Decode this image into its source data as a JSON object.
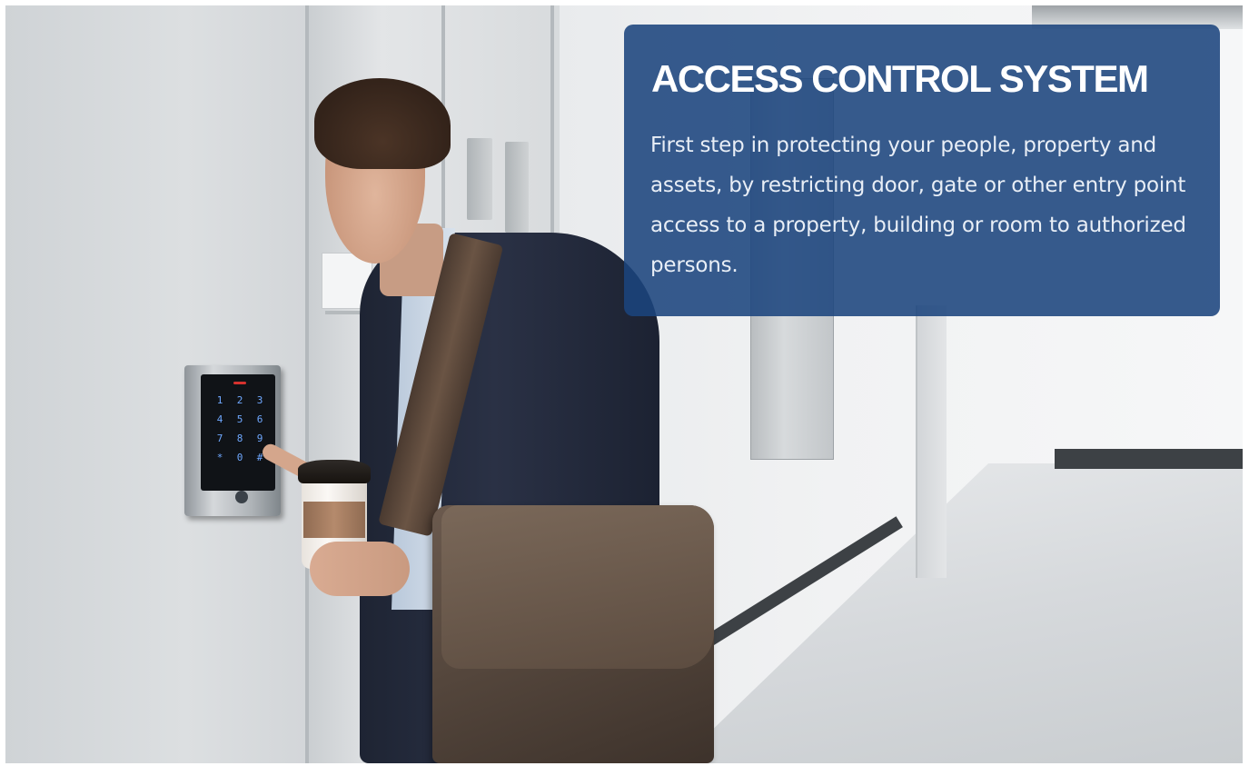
{
  "banner": {
    "title": "ACCESS CONTROL SYSTEM",
    "description": "First step in protecting your people, property and assets, by restricting door, gate or other entry point access to a property, building or room to authorized persons."
  },
  "keypad": {
    "keys": [
      "1",
      "2",
      "3",
      "4",
      "5",
      "6",
      "7",
      "8",
      "9",
      "*",
      "0",
      "#"
    ]
  },
  "colors": {
    "banner_background": "#1b447d",
    "title_text": "#ffffff",
    "keypad_key_glow": "#6fa8ff",
    "keypad_indicator": "#d6322e"
  }
}
